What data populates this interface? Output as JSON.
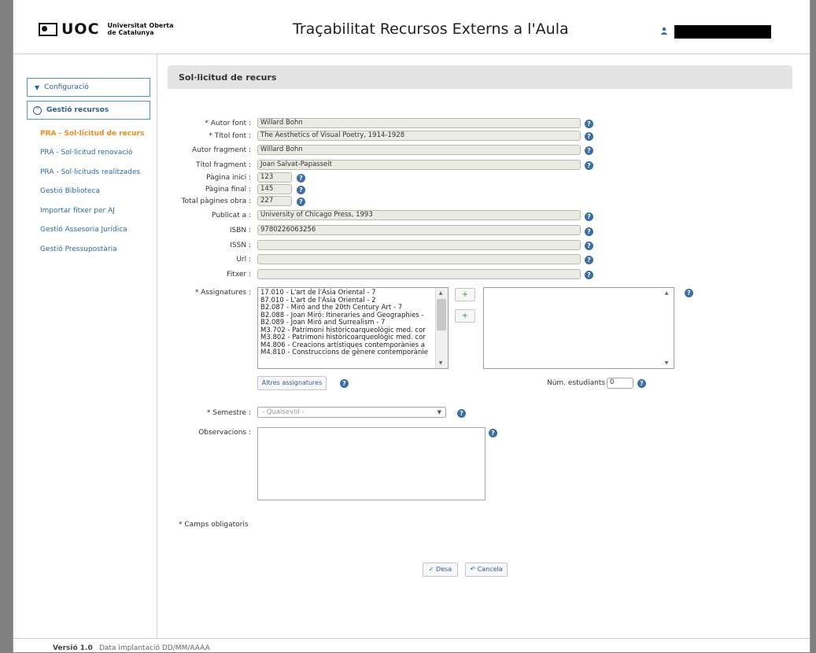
{
  "header": {
    "logo_text": "UOC",
    "logo_sub_1": "Universitat Oberta",
    "logo_sub_2": "de Catalunya",
    "title": "Traçabilitat Recursos Externs a l'Aula"
  },
  "sidebar": {
    "config_label": "Configuració",
    "gestio_label": "Gestió recursos",
    "links": [
      "PRA - Sol·licitud de recurs",
      "PRA - Sol·licitud renovació",
      "PRA - Sol·licituds realitzades",
      "Gestió Biblioteca",
      "Importar fitxer per AJ",
      "Gestió Assesoria Jurídica",
      "Gestió Pressupostària"
    ]
  },
  "section_title": "Sol·licitud de recurs",
  "form": {
    "autor_font": {
      "label": "* Autor font :",
      "value": "Willard Bohn"
    },
    "titol_font": {
      "label": "* Títol font :",
      "value": "The Aesthetics of Visual Poetry, 1914-1928"
    },
    "autor_fragment": {
      "label": "Autor fragment :",
      "value": "Willard Bohn"
    },
    "titol_fragment": {
      "label": "Títol fragment :",
      "value": "Joan Salvat-Papasseit"
    },
    "pagina_inici": {
      "label": "Pàgina inici :",
      "value": "123"
    },
    "pagina_final": {
      "label": "Pàgina final :",
      "value": "145"
    },
    "total_pagines": {
      "label": "Total pàgines obra :",
      "value": "227"
    },
    "publicat": {
      "label": "Publicat a :",
      "value": "University of Chicago Press, 1993"
    },
    "isbn": {
      "label": "ISBN :",
      "value": "9780226063256"
    },
    "issn": {
      "label": "ISSN :",
      "value": ""
    },
    "url": {
      "label": "Url :",
      "value": ""
    },
    "fitxer": {
      "label": "Fitxer :",
      "value": ""
    },
    "assignatures_label": "* Assignatures :",
    "assignatures": [
      "17.010 - L'art de l'Àsia Oriental - 7",
      "87.010 - L'art de l'Àsia Oriental - 2",
      "B2.087 - Miró and the 20th Century Art - 7",
      "B2.088 - Joan Miró: Itineraries and Geographies -",
      "B2.089 - Joan Miró and Surrealism - 7",
      "M3.702 - Patrimoni històricoarqueològic med. cor",
      "M3.802 - Patrimoni històricoarqueològic med. cor",
      "M4.806 - Creacions artístiques contemporànies a",
      "M4.810 - Construccions de gènere contemporànie"
    ],
    "altres_label": "Altres assignatures",
    "num_estudiants_label": "Núm. estudiants :",
    "num_estudiants_value": "0",
    "semestre_label": "* Semestre :",
    "semestre_value": "- Qualsevol -",
    "observacions_label": "Observacions :",
    "required_note": "* Camps obligatoris",
    "desa_label": "Desa",
    "cancela_label": "Cancela"
  },
  "footer": {
    "version": "Versió 1.0",
    "date_text": "Data implantació DD/MM/AAAA"
  },
  "colors": {
    "accent": "#f08a24",
    "link": "#2f6b9c",
    "help": "#3b6ea5"
  }
}
